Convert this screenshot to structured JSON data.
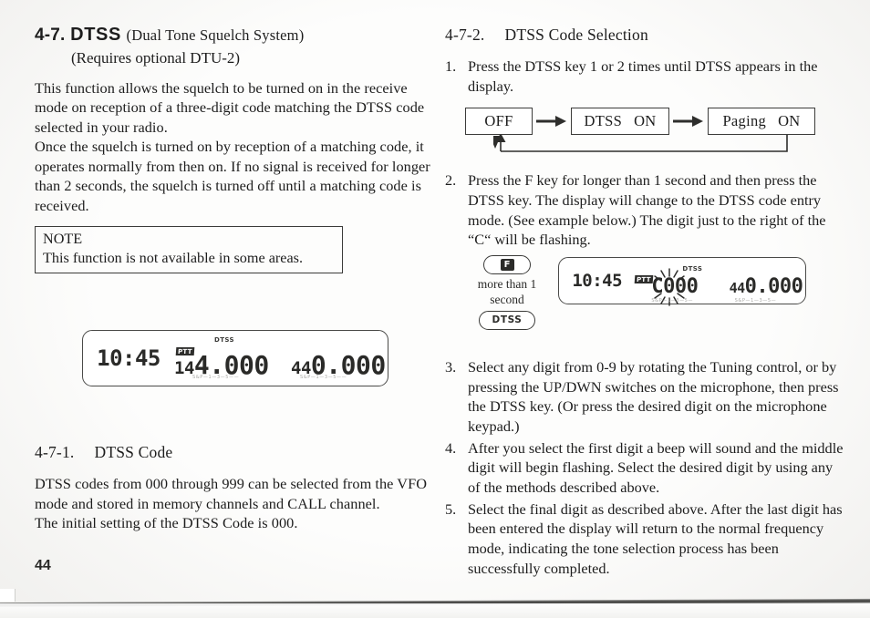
{
  "page": {
    "number": "44"
  },
  "left": {
    "heading": {
      "number": "4-7.",
      "acronym": "DTSS",
      "expansion": "(Dual Tone Squelch System)",
      "requires": "(Requires optional DTU-2)"
    },
    "intro_paragraph_1": "This function allows the squelch to be turned on in the receive mode on reception of a three-digit code matching the DTSS code selected in your radio.",
    "intro_paragraph_2": "Once the squelch is turned on by reception of a matching code, it operates normally from then on. If no signal is received for longer than 2 seconds, the squelch is turned off until a matching code is received.",
    "note": {
      "title": "NOTE",
      "text": "This function is not available in some areas."
    },
    "lcd": {
      "clock": "10:45",
      "ptt_badge": "PTT",
      "band_a_prefix": "14",
      "band_a_main": "4.000",
      "dtss_label": "DTSS",
      "band_b_prefix": "44",
      "band_b_main": "0.000",
      "smeter_scale": "S 1 3 5 7 9",
      "smeter_label": "S&P"
    },
    "subsection": {
      "number": "4-7-1.",
      "title": "DTSS Code",
      "paragraph_1": "DTSS codes from 000 through 999 can be selected from the VFO mode and stored in memory channels and CALL channel.",
      "paragraph_2": "The initial setting of the DTSS Code is 000."
    }
  },
  "right": {
    "subsection": {
      "number": "4-7-2.",
      "title": "DTSS Code Selection"
    },
    "steps": [
      {
        "mark": "1.",
        "text": "Press the DTSS key 1 or 2 times until DTSS appears in the display."
      },
      {
        "mark": "2.",
        "text": "Press the F key for longer than 1 second and then press the DTSS key. The display will change to the DTSS code entry mode. (See example below.) The digit just to the right of the “C“ will be flashing."
      },
      {
        "mark": "3.",
        "text": "Select any digit from 0-9 by rotating the Tuning control, or by pressing the UP/DWN switches on the microphone, then press the DTSS key. (Or press the desired digit on the microphone keypad.)"
      },
      {
        "mark": "4.",
        "text": "After you select the first digit a beep will sound and the middle digit will begin flashing. Select the desired digit by using any of the methods described above."
      },
      {
        "mark": "5.",
        "text": "Select the final digit as described above. After the last digit has been entered the display will return to the normal frequency mode, indicating the tone selection process has been successfully completed."
      }
    ],
    "flow": {
      "state_off": "OFF",
      "state_dtss_name": "DTSS",
      "state_dtss_value": "ON",
      "state_paging_name": "Paging",
      "state_paging_value": "ON"
    },
    "keys": {
      "f_key": "F",
      "caption_line_1": "more than 1",
      "caption_line_2": "second",
      "dtss_key": "DTSS"
    },
    "lcd": {
      "clock": "10:45",
      "ptt_badge": "PTT",
      "code_prefix": "C",
      "code_flashing_digit": "0",
      "code_rest": "00",
      "dtss_label": "DTSS",
      "band_b_prefix": "44",
      "band_b_main": "0.000",
      "smeter_label": "S&P"
    }
  },
  "colors": {
    "ink": "#1d1d1d",
    "paper": "#fdfdfc",
    "rule": "#3b3b39"
  }
}
